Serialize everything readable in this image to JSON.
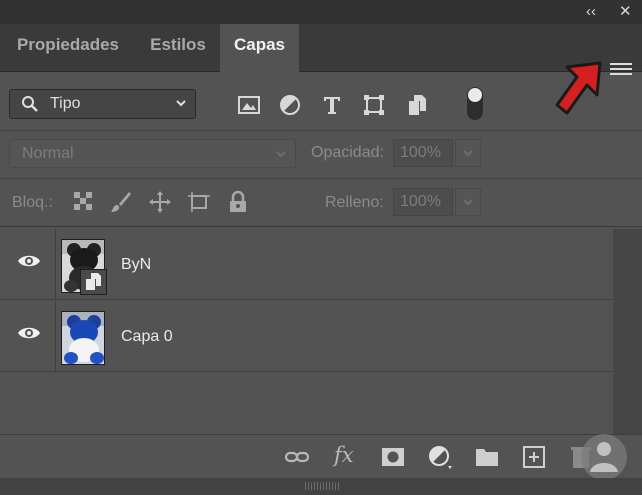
{
  "window": {
    "collapse_glyph": "‹‹",
    "close_glyph": "✕"
  },
  "tabs": [
    {
      "label": "Propiedades",
      "active": false
    },
    {
      "label": "Estilos",
      "active": false
    },
    {
      "label": "Capas",
      "active": true
    }
  ],
  "filter": {
    "kind_value": "Tipo",
    "icons": [
      "image-filter-icon",
      "adjustment-filter-icon",
      "type-filter-icon",
      "shape-filter-icon",
      "smart-object-filter-icon",
      "filter-toggle"
    ]
  },
  "blend": {
    "mode_value": "Normal",
    "opacity_label": "Opacidad:",
    "opacity_value": "100%"
  },
  "lock": {
    "label": "Bloq.:",
    "fill_label": "Relleno:",
    "fill_value": "100%",
    "icons": [
      "lock-transparent-pixels-icon",
      "lock-image-pixels-icon",
      "lock-position-icon",
      "prevent-autonest-icon",
      "lock-all-icon"
    ]
  },
  "layers": [
    {
      "name": "ByN",
      "visible": true,
      "smart_object": true
    },
    {
      "name": "Capa 0",
      "visible": true,
      "smart_object": false
    }
  ],
  "bottom_bar": {
    "icons": [
      "link-layers-icon",
      "fx-icon",
      "mask-icon",
      "adjustment-layer-icon",
      "group-folder-icon",
      "new-layer-icon",
      "delete-icon"
    ],
    "fx_label": "fx"
  },
  "colors": {
    "panel": "#535353",
    "tab_bar": "#3a3a3a",
    "annotation_arrow": "#d42020"
  }
}
